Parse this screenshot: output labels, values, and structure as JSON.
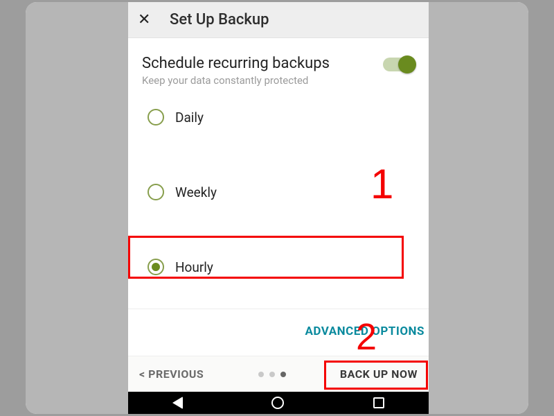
{
  "header": {
    "close_glyph": "✕",
    "title": "Set Up Backup"
  },
  "schedule": {
    "title": "Schedule recurring backups",
    "subtitle": "Keep your data constantly protected",
    "toggle_on": true
  },
  "options": {
    "daily": {
      "label": "Daily",
      "selected": false
    },
    "weekly": {
      "label": "Weekly",
      "selected": false
    },
    "hourly": {
      "label": "Hourly",
      "selected": true
    }
  },
  "advanced_label": "ADVANCED OPTIONS",
  "footer": {
    "prev": "< PREVIOUS",
    "next": "BACK UP NOW",
    "page_index": 2,
    "page_count": 3
  },
  "annotations": {
    "label1": "1",
    "label2": "2"
  }
}
